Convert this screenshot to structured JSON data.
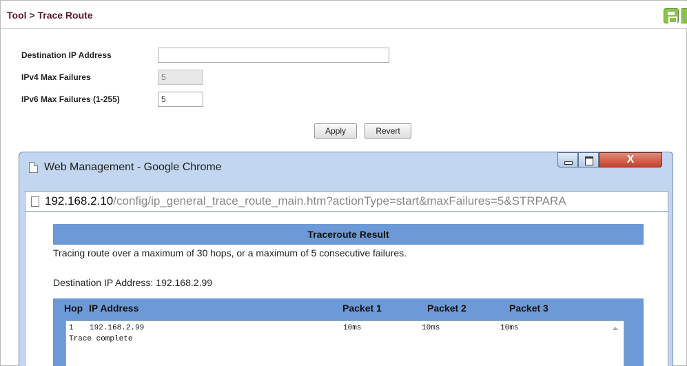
{
  "header": {
    "title": "Tool > Trace Route"
  },
  "icons": {
    "save": "save-icon",
    "page": "page-icon"
  },
  "form": {
    "dest_ip_label": "Destination IP Address",
    "dest_ip_value": "",
    "ipv4_label": "IPv4 Max Failures",
    "ipv4_value": "5",
    "ipv6_label": "IPv6 Max Failures (1-255)",
    "ipv6_value": "5",
    "apply_label": "Apply",
    "revert_label": "Revert"
  },
  "popup": {
    "title": "Web Management - Google Chrome",
    "close_glyph": "X",
    "url_host": "192.168.2.10",
    "url_path": "/config/ip_general_trace_route_main.htm?actionType=start&maxFailures=5&STRPARA",
    "result_title": "Traceroute Result",
    "tracing_text": "Tracing route over a maximum of 30 hops, or a maximum of 5 consecutive failures.",
    "dest_label": "Destination IP Address:",
    "dest_value": "192.168.2.99",
    "columns": [
      "Hop",
      "IP Address",
      "Packet 1",
      "Packet 2",
      "Packet 3"
    ],
    "rows": [
      {
        "hop": "1",
        "ip": "192.168.2.99",
        "p1": "10ms",
        "p2": "10ms",
        "p3": "10ms"
      }
    ],
    "complete_text": "Trace complete"
  },
  "colors": {
    "title_text": "#5b1a2a",
    "result_header_bg": "#6d9ad6",
    "window_frame": "#c3d6ef",
    "close_button": "#c3412a",
    "save_icon": "#8bc34a"
  }
}
